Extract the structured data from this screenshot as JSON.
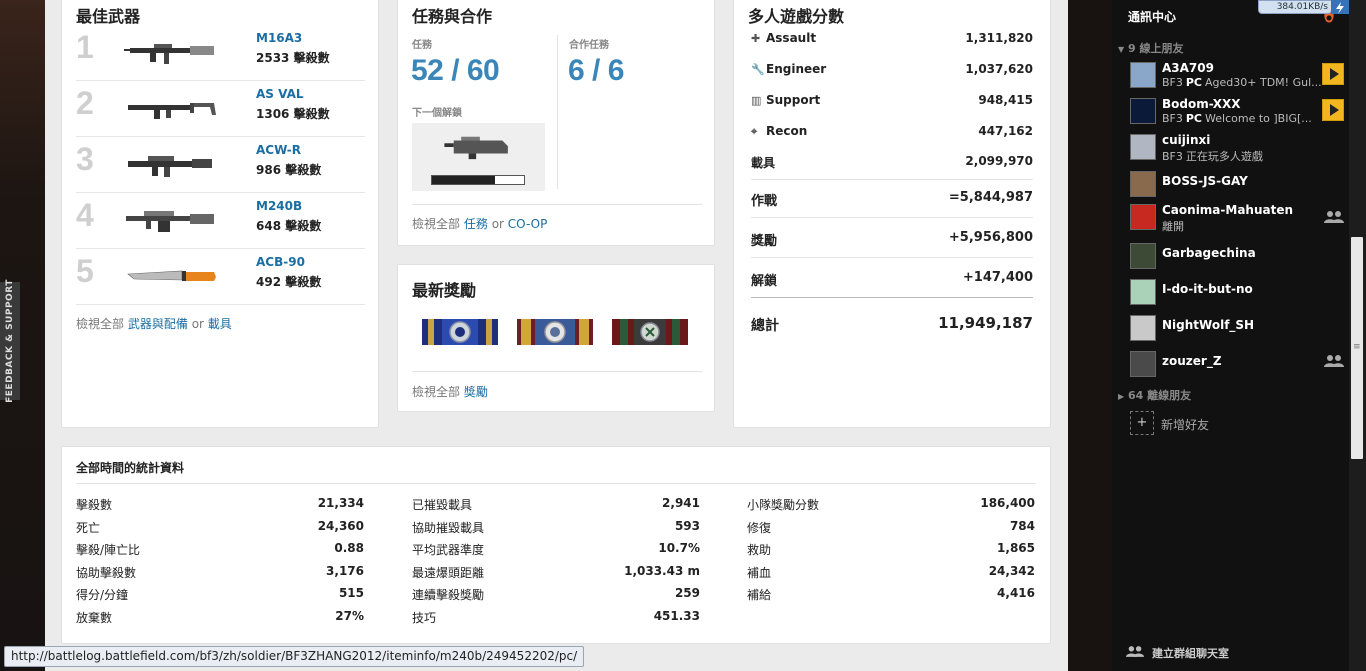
{
  "weapons": {
    "title": "最佳武器",
    "items": [
      {
        "rank": "1",
        "name": "M16A3",
        "kills": "2533 擊殺數"
      },
      {
        "rank": "2",
        "name": "AS VAL",
        "kills": "1306 擊殺數"
      },
      {
        "rank": "3",
        "name": "ACW-R",
        "kills": "986 擊殺數"
      },
      {
        "rank": "4",
        "name": "M240B",
        "kills": "648 擊殺數"
      },
      {
        "rank": "5",
        "name": "ACB-90",
        "kills": "492 擊殺數"
      }
    ],
    "footer_prefix": "檢視全部",
    "footer_link1": "武器與配備",
    "footer_or": "or",
    "footer_link2": "載具"
  },
  "missions": {
    "title": "任務與合作",
    "missions_label": "任務",
    "missions_value": "52 / 60",
    "coop_label": "合作任務",
    "coop_value": "6 / 6",
    "next_unlock_label": "下一個解鎖",
    "next_unlock_progress": 0.68,
    "footer_prefix": "檢視全部",
    "footer_link1": "任務",
    "footer_or": "or",
    "footer_link2": "CO-OP"
  },
  "awards": {
    "title": "最新獎勵",
    "footer_prefix": "檢視全部",
    "footer_link": "獎勵"
  },
  "scores": {
    "title": "多人遊戲分數",
    "rows": [
      {
        "label": "Assault",
        "value": "1,311,820",
        "icon": "plus-icon"
      },
      {
        "label": "Engineer",
        "value": "1,037,620",
        "icon": "wrench-icon"
      },
      {
        "label": "Support",
        "value": "948,415",
        "icon": "ammo-icon"
      },
      {
        "label": "Recon",
        "value": "447,162",
        "icon": "crosshair-icon"
      },
      {
        "label": "載具",
        "value": "2,099,970"
      }
    ],
    "combat_label": "作戰",
    "combat_value": "=5,844,987",
    "award_label": "獎勵",
    "award_value": "+5,956,800",
    "unlock_label": "解鎖",
    "unlock_value": "+147,400",
    "total_label": "總計",
    "total_value": "11,949,187"
  },
  "alltime": {
    "title": "全部時間的統計資料",
    "col1": [
      {
        "label": "擊殺數",
        "value": "21,334"
      },
      {
        "label": "死亡",
        "value": "24,360"
      },
      {
        "label": "擊殺/陣亡比",
        "value": "0.88"
      },
      {
        "label": "協助擊殺數",
        "value": "3,176"
      },
      {
        "label": "得分/分鐘",
        "value": "515"
      },
      {
        "label": "放棄數",
        "value": "27%"
      }
    ],
    "col2": [
      {
        "label": "已摧毀載具",
        "value": "2,941"
      },
      {
        "label": "協助摧毀載具",
        "value": "593"
      },
      {
        "label": "平均武器準度",
        "value": "10.7%"
      },
      {
        "label": "最遠爆頭距離",
        "value": "1,033.43 m"
      },
      {
        "label": "連續擊殺獎勵",
        "value": "259"
      },
      {
        "label": "技巧",
        "value": "451.33"
      }
    ],
    "col3": [
      {
        "label": "小隊獎勵分數",
        "value": "186,400"
      },
      {
        "label": "修復",
        "value": "784"
      },
      {
        "label": "救助",
        "value": "1,865"
      },
      {
        "label": "補血",
        "value": "24,342"
      },
      {
        "label": "補給",
        "value": "4,416"
      }
    ]
  },
  "feedback_label": "FEEDBACK & SUPPORT",
  "status_url": "http://battlelog.battlefield.com/bf3/zh/soldier/BF3ZHANG2012/iteminfo/m240b/249452202/pc/",
  "sidebar": {
    "title": "通訊中心",
    "net_speed": "384.01KB/s",
    "online_section": "9 線上朋友",
    "offline_section": "64 離線朋友",
    "add_friend": "新增好友",
    "chat_room": "建立群組聊天室",
    "friends": [
      {
        "name": "A3A709",
        "platform": "PC",
        "status_prefix": "BF3",
        "status": "Aged30+ TDM! Gul...",
        "action": "play"
      },
      {
        "name": "Bodom-XXX",
        "platform": "PC",
        "status_prefix": "BF3",
        "status": "Welcome to ]BIG[...",
        "action": "play"
      },
      {
        "name": "cuijinxi",
        "status_prefix": "BF3",
        "status": "正在玩多人遊戲"
      },
      {
        "name": "BOSS-JS-GAY"
      },
      {
        "name": "Caonima-Mahuaten",
        "status": "離開",
        "action": "group"
      },
      {
        "name": "Garbagechina"
      },
      {
        "name": "I-do-it-but-no"
      },
      {
        "name": "NightWolf_SH"
      },
      {
        "name": "zouzer_Z",
        "action": "group"
      }
    ]
  }
}
